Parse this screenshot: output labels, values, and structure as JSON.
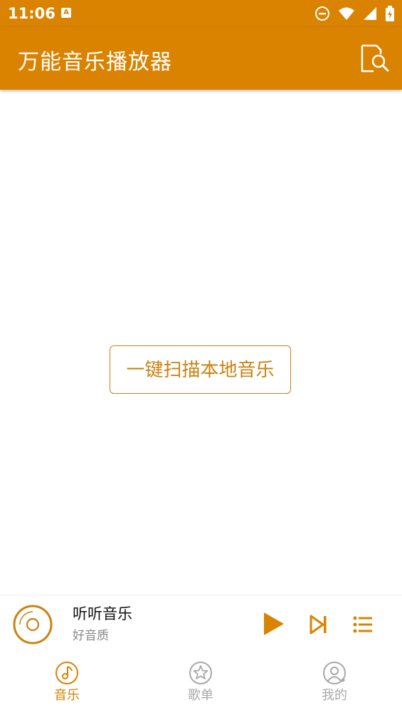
{
  "status": {
    "time": "11:06",
    "a_badge": "A"
  },
  "appbar": {
    "title": "万能音乐播放器"
  },
  "main": {
    "scan_button_label": "一键扫描本地音乐"
  },
  "player": {
    "title": "听听音乐",
    "subtitle": "好音质"
  },
  "nav": {
    "items": [
      {
        "label": "音乐",
        "icon": "music-note-icon",
        "active": true
      },
      {
        "label": "歌单",
        "icon": "star-icon",
        "active": false
      },
      {
        "label": "我的",
        "icon": "user-icon",
        "active": false
      }
    ]
  },
  "colors": {
    "accent": "#d98300",
    "inactive": "#a8a8a8"
  }
}
